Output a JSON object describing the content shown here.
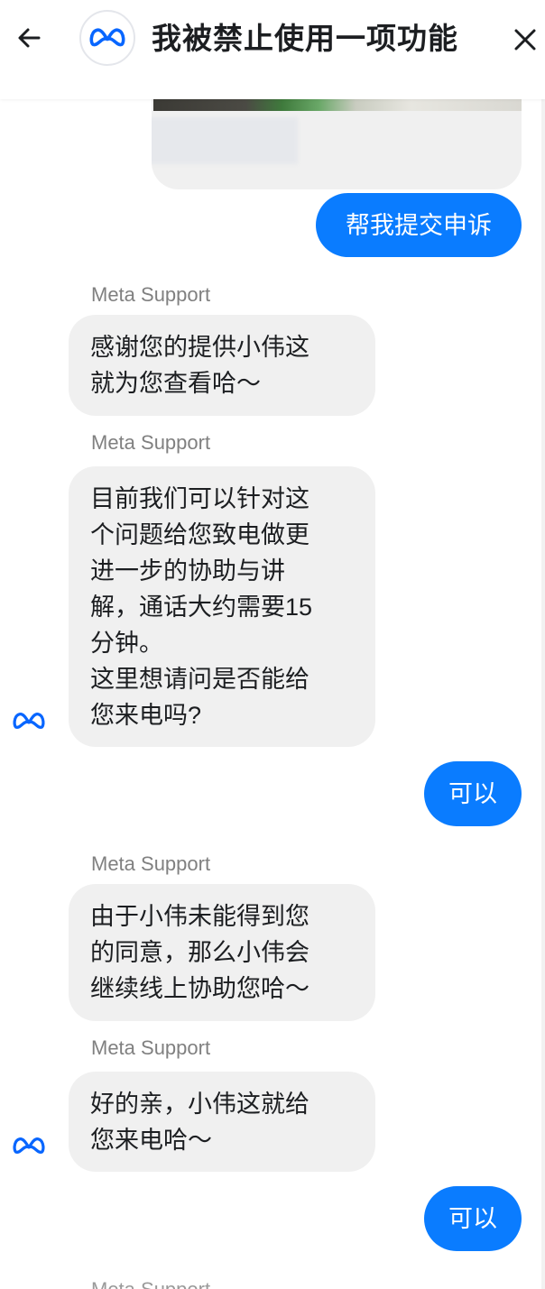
{
  "header": {
    "title": "我被禁止使用一项功能",
    "back_icon": "arrow-left-icon",
    "logo_icon": "meta-logo-icon",
    "close_icon": "close-icon"
  },
  "colors": {
    "outgoing_bubble": "#0a7cff",
    "incoming_bubble": "#f0f0f0",
    "meta_blue": "#0866ff",
    "sender_gray": "#808080"
  },
  "messages": [
    {
      "id": "m1",
      "direction": "out",
      "text": "帮我提交申诉"
    },
    {
      "id": "m2",
      "direction": "in",
      "sender": "Meta Support",
      "text": "感谢您的提供小伟这\n就为您查看哈～"
    },
    {
      "id": "m3",
      "direction": "in",
      "sender": "Meta Support",
      "text": "目前我们可以针对这\n个问题给您致电做更\n进一步的协助与讲\n解，通话大约需要15\n分钟。\n这里想请问是否能给\n您来电吗?"
    },
    {
      "id": "m4",
      "direction": "out",
      "text": "可以"
    },
    {
      "id": "m5",
      "direction": "in",
      "sender": "Meta Support",
      "text": "由于小伟未能得到您\n的同意，那么小伟会\n继续线上协助您哈～"
    },
    {
      "id": "m6",
      "direction": "in",
      "sender": "Meta Support",
      "text": "好的亲，小伟这就给\n您来电哈～"
    },
    {
      "id": "m7",
      "direction": "out",
      "text": "可以"
    }
  ],
  "trailing_sender": "Meta Support"
}
